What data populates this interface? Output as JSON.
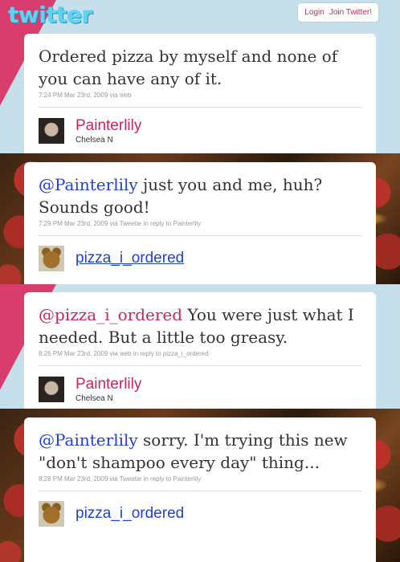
{
  "header": {
    "logo": "twitter",
    "login": "Login",
    "join": "Join Twitter!"
  },
  "colors": {
    "pink": "#c9265a",
    "blue": "#1f3fd6",
    "text": "#333333"
  },
  "tweets": [
    {
      "mention": "",
      "text": "Ordered pizza by myself and none of you can have any of it.",
      "meta": "7:24 PM Mar 23rd, 2009 via web",
      "screen_name": "Painterlily",
      "full_name": "Chelsea N",
      "avatar": "woman-photo"
    },
    {
      "mention": "@Painterlily",
      "text": " just you and me, huh? Sounds good!",
      "meta": "7:29 PM Mar 23rd, 2009 via Tweetie in reply to Painterlily",
      "screen_name": "pizza_i_ordered",
      "full_name": "",
      "avatar": "teddy-bear-photo"
    },
    {
      "mention": "@pizza_i_ordered",
      "text": " You were just what I needed. But a little too greasy.",
      "meta": "8:26 PM Mar 23rd, 2009 via web in reply to pizza_i_ordered",
      "screen_name": "Painterlily",
      "full_name": "Chelsea N",
      "avatar": "woman-photo"
    },
    {
      "mention": "@Painterlily",
      "text": " sorry. I'm trying this new \"don't shampoo every day\" thing...",
      "meta": "8:28 PM Mar 23rd, 2009 via Tweetie in reply to Painterlily",
      "screen_name": "pizza_i_ordered",
      "full_name": "",
      "avatar": "teddy-bear-photo"
    }
  ]
}
